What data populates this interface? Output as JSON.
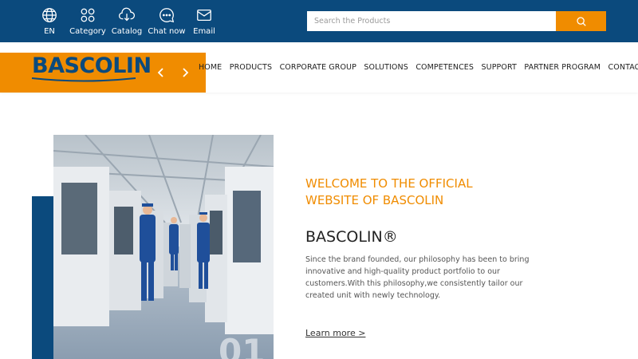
{
  "toolbar": {
    "items": [
      {
        "label": "EN",
        "icon": "globe-icon"
      },
      {
        "label": "Category",
        "icon": "category-icon"
      },
      {
        "label": "Catalog",
        "icon": "download-icon"
      },
      {
        "label": "Chat now",
        "icon": "chat-icon"
      },
      {
        "label": "Email",
        "icon": "mail-icon"
      }
    ]
  },
  "search": {
    "placeholder": "Search the Products",
    "button_icon": "search-icon"
  },
  "header": {
    "logo_text": "BASCOLIN",
    "nav": [
      "HOME",
      "PRODUCTS",
      "CORPORATE GROUP",
      "SOLUTIONS",
      "COMPETENCES",
      "SUPPORT",
      "PARTNER PROGRAM",
      "CONTACT"
    ]
  },
  "hero": {
    "slide_number": "01",
    "welcome": "WELCOME TO THE OFFICIAL WEBSITE OF BASCOLIN",
    "title": "BASCOLIN®",
    "description": "Since the brand founded, our philosophy has been to bring innovative and high-quality product portfolio to our customers.With this philosophy,we consistently tailor our created unit with newly technology.",
    "link": "Learn more >"
  },
  "colors": {
    "primary_blue": "#0b4a7d",
    "accent_orange": "#f08c00"
  }
}
